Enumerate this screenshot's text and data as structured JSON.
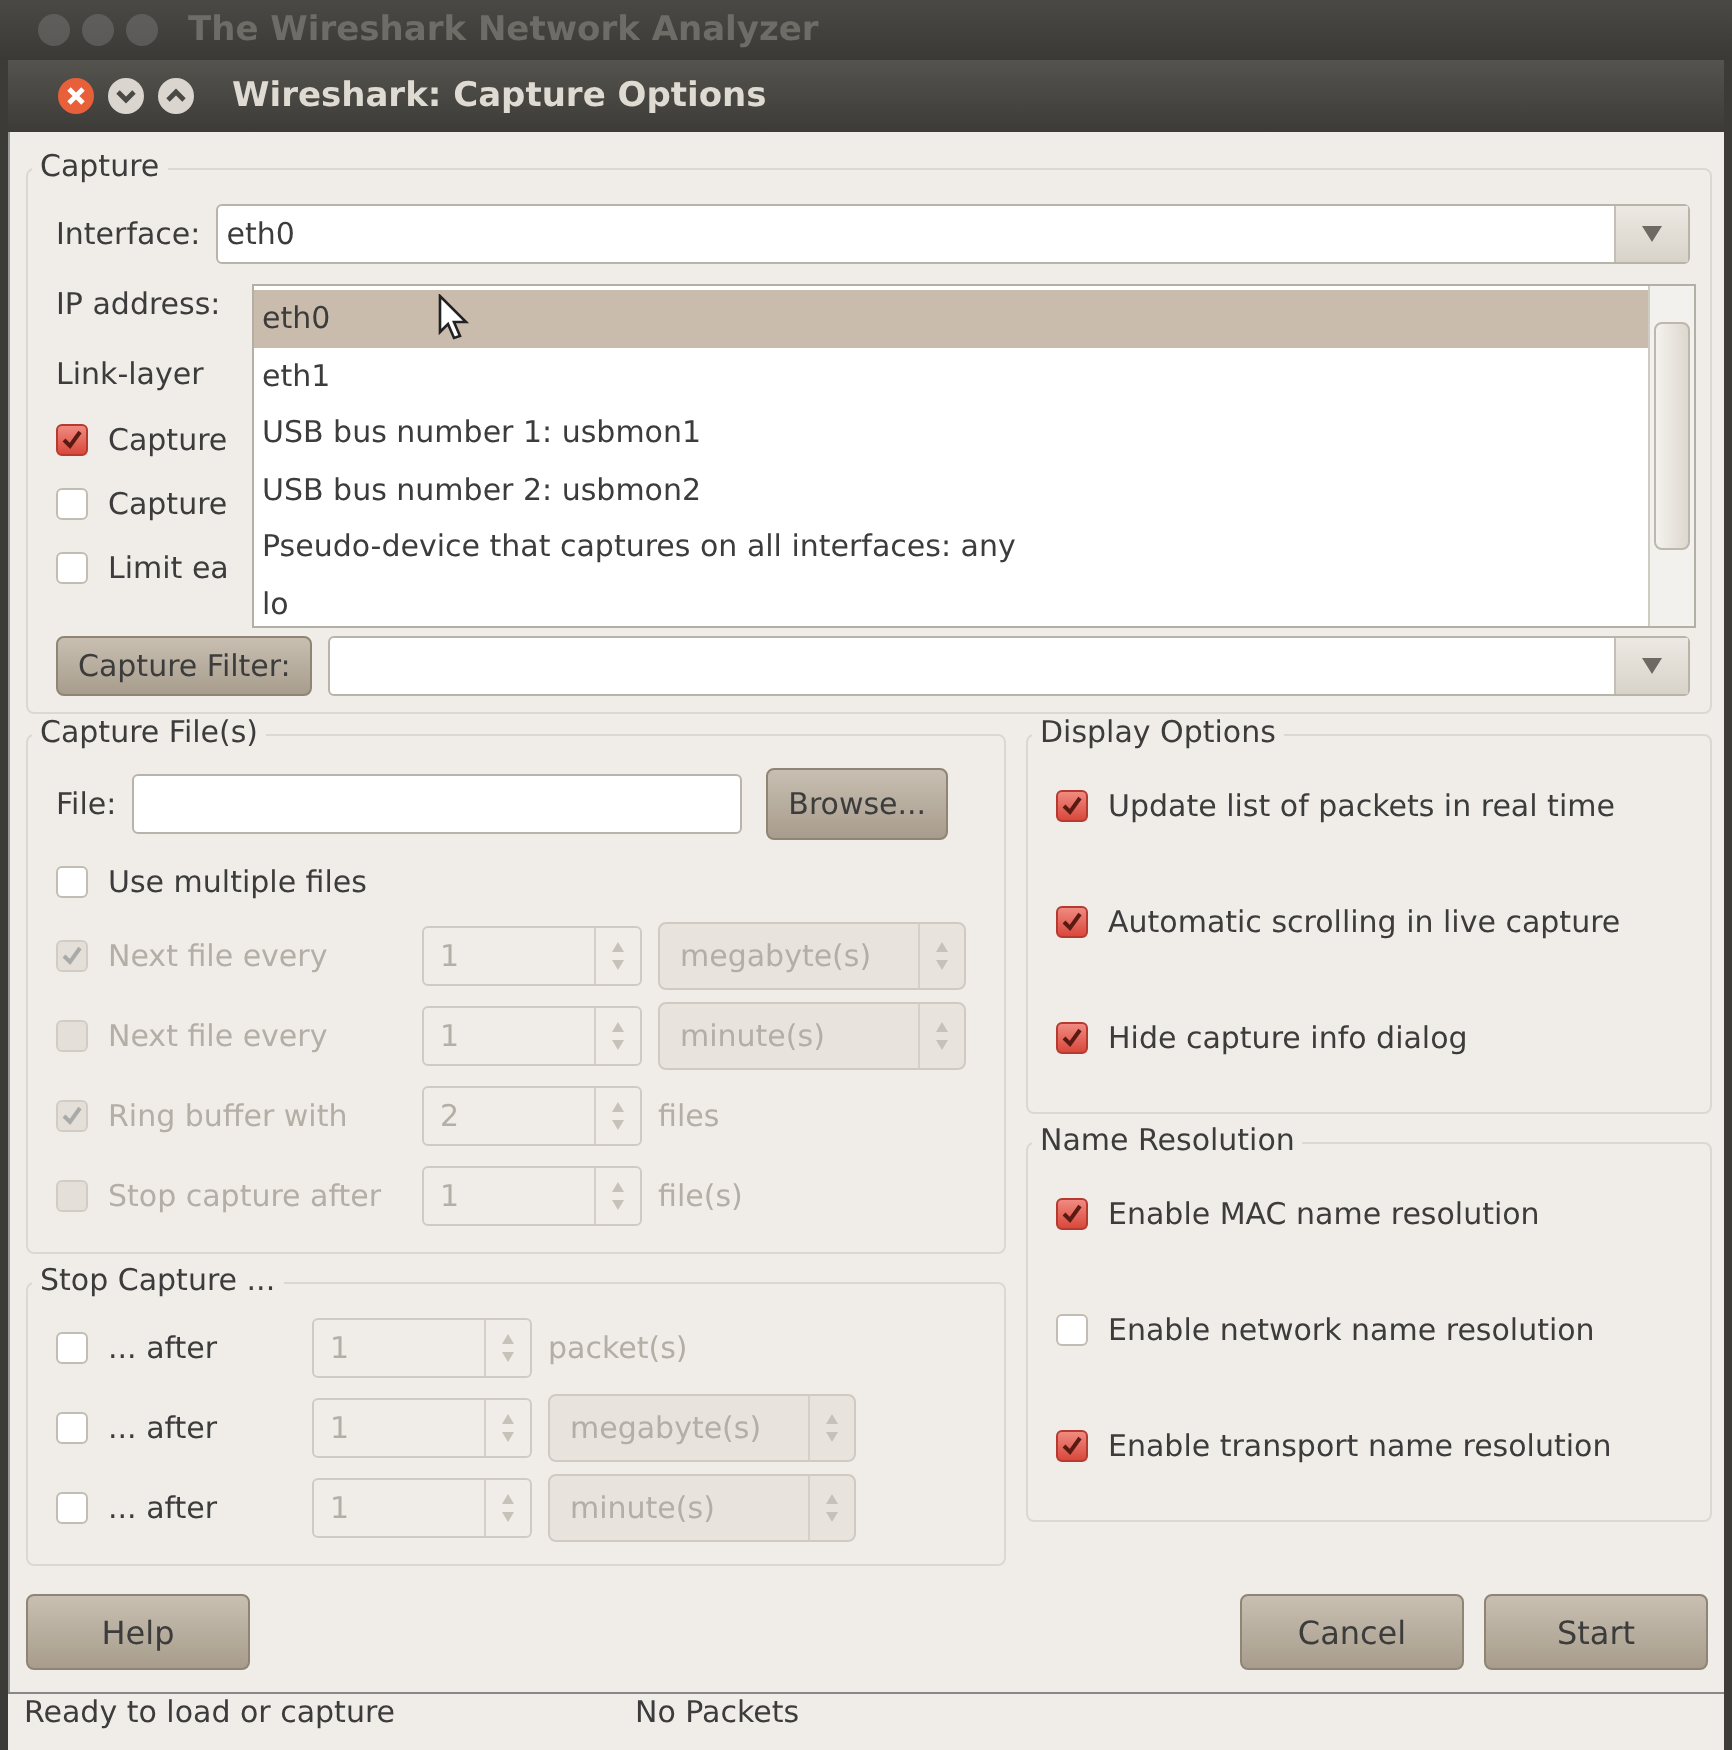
{
  "background_window": {
    "title": "The Wireshark Network Analyzer"
  },
  "window": {
    "title": "Wireshark: Capture Options"
  },
  "capture": {
    "title": "Capture",
    "interface_label": "Interface:",
    "interface_value": "eth0",
    "ip_address_label": "IP address:",
    "link_layer_label": "Link-layer",
    "options": [
      {
        "label": "Capture",
        "checked": true
      },
      {
        "label": "Capture",
        "checked": false
      },
      {
        "label": "Limit ea",
        "checked": false
      }
    ],
    "filter_button": "Capture Filter:"
  },
  "interface_dropdown": {
    "items": [
      {
        "label": "eth0",
        "selected": true
      },
      {
        "label": "eth1",
        "selected": false
      },
      {
        "label": "USB bus number 1: usbmon1",
        "selected": false
      },
      {
        "label": "USB bus number 2: usbmon2",
        "selected": false
      },
      {
        "label": "Pseudo-device that captures on all interfaces: any",
        "selected": false
      },
      {
        "label": "lo",
        "selected": false
      }
    ]
  },
  "capture_files": {
    "title": "Capture File(s)",
    "file_label": "File:",
    "browse_button": "Browse...",
    "multiple_files": {
      "label": "Use multiple files",
      "checked": false
    },
    "rows": [
      {
        "kind": "combo",
        "label": "Next file every",
        "checked": true,
        "disabled": true,
        "inputs_disabled": true,
        "value": "1",
        "unit": "megabyte(s)"
      },
      {
        "kind": "combo",
        "label": "Next file every",
        "checked": false,
        "disabled": true,
        "inputs_disabled": true,
        "value": "1",
        "unit": "minute(s)"
      },
      {
        "kind": "text",
        "label": "Ring buffer with",
        "checked": true,
        "disabled": true,
        "inputs_disabled": true,
        "value": "2",
        "unit": "files"
      },
      {
        "kind": "text",
        "label": "Stop capture after",
        "checked": false,
        "disabled": true,
        "inputs_disabled": true,
        "value": "1",
        "unit": "file(s)"
      }
    ]
  },
  "stop_capture": {
    "title": "Stop Capture ...",
    "rows": [
      {
        "kind": "text",
        "label": "... after",
        "checked": false,
        "disabled": false,
        "inputs_disabled": true,
        "value": "1",
        "unit": "packet(s)"
      },
      {
        "kind": "combo",
        "label": "... after",
        "checked": false,
        "disabled": false,
        "inputs_disabled": true,
        "value": "1",
        "unit": "megabyte(s)"
      },
      {
        "kind": "combo",
        "label": "... after",
        "checked": false,
        "disabled": false,
        "inputs_disabled": true,
        "value": "1",
        "unit": "minute(s)"
      }
    ]
  },
  "display_options": {
    "title": "Display Options",
    "options": [
      {
        "label": "Update list of packets in real time",
        "checked": true
      },
      {
        "label": "Automatic scrolling in live capture",
        "checked": true
      },
      {
        "label": "Hide capture info dialog",
        "checked": true
      }
    ]
  },
  "name_resolution": {
    "title": "Name Resolution",
    "options": [
      {
        "label": "Enable MAC name resolution",
        "checked": true
      },
      {
        "label": "Enable network name resolution",
        "checked": false
      },
      {
        "label": "Enable transport name resolution",
        "checked": true
      }
    ]
  },
  "buttons": {
    "help": "Help",
    "cancel": "Cancel",
    "start": "Start"
  },
  "status_bar": {
    "message": "Ready to load or capture",
    "packets": "No Packets"
  }
}
